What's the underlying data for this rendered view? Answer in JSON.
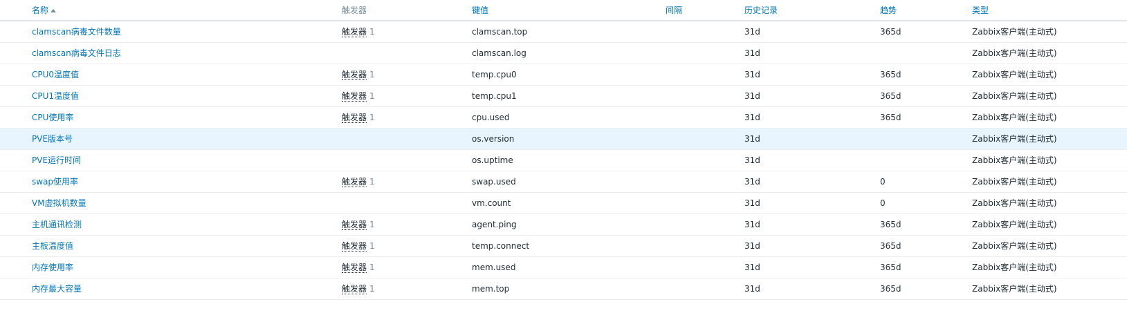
{
  "colors": {
    "link": "#0275b8",
    "header_muted": "#768d99",
    "highlight_row": "#e8f5ff",
    "text": "#1f2c33"
  },
  "header": {
    "name": "名称",
    "triggers": "触发器",
    "key": "键值",
    "interval": "间隔",
    "history": "历史记录",
    "trends": "趋势",
    "type": "类型",
    "sort_icon": "sort-ascending-icon"
  },
  "rows": [
    {
      "name": "clamscan病毒文件数量",
      "trigger_label": "触发器",
      "trigger_count": "1",
      "key": "clamscan.top",
      "interval": "",
      "history": "31d",
      "trends": "365d",
      "type": "Zabbix客户端(主动式)"
    },
    {
      "name": "clamscan病毒文件日志",
      "trigger_label": "",
      "trigger_count": "",
      "key": "clamscan.log",
      "interval": "",
      "history": "31d",
      "trends": "",
      "type": "Zabbix客户端(主动式)"
    },
    {
      "name": "CPU0温度值",
      "trigger_label": "触发器",
      "trigger_count": "1",
      "key": "temp.cpu0",
      "interval": "",
      "history": "31d",
      "trends": "365d",
      "type": "Zabbix客户端(主动式)"
    },
    {
      "name": "CPU1温度值",
      "trigger_label": "触发器",
      "trigger_count": "1",
      "key": "temp.cpu1",
      "interval": "",
      "history": "31d",
      "trends": "365d",
      "type": "Zabbix客户端(主动式)"
    },
    {
      "name": "CPU使用率",
      "trigger_label": "触发器",
      "trigger_count": "1",
      "key": "cpu.used",
      "interval": "",
      "history": "31d",
      "trends": "365d",
      "type": "Zabbix客户端(主动式)"
    },
    {
      "name": "PVE版本号",
      "trigger_label": "",
      "trigger_count": "",
      "key": "os.version",
      "interval": "",
      "history": "31d",
      "trends": "",
      "type": "Zabbix客户端(主动式)",
      "highlighted": true
    },
    {
      "name": "PVE运行时间",
      "trigger_label": "",
      "trigger_count": "",
      "key": "os.uptime",
      "interval": "",
      "history": "31d",
      "trends": "",
      "type": "Zabbix客户端(主动式)"
    },
    {
      "name": "swap使用率",
      "trigger_label": "触发器",
      "trigger_count": "1",
      "key": "swap.used",
      "interval": "",
      "history": "31d",
      "trends": "0",
      "type": "Zabbix客户端(主动式)"
    },
    {
      "name": "VM虚拟机数量",
      "trigger_label": "",
      "trigger_count": "",
      "key": "vm.count",
      "interval": "",
      "history": "31d",
      "trends": "0",
      "type": "Zabbix客户端(主动式)"
    },
    {
      "name": "主机通讯检测",
      "trigger_label": "触发器",
      "trigger_count": "1",
      "key": "agent.ping",
      "interval": "",
      "history": "31d",
      "trends": "365d",
      "type": "Zabbix客户端(主动式)"
    },
    {
      "name": "主板温度值",
      "trigger_label": "触发器",
      "trigger_count": "1",
      "key": "temp.connect",
      "interval": "",
      "history": "31d",
      "trends": "365d",
      "type": "Zabbix客户端(主动式)"
    },
    {
      "name": "内存使用率",
      "trigger_label": "触发器",
      "trigger_count": "1",
      "key": "mem.used",
      "interval": "",
      "history": "31d",
      "trends": "365d",
      "type": "Zabbix客户端(主动式)"
    },
    {
      "name": "内存最大容量",
      "trigger_label": "触发器",
      "trigger_count": "1",
      "key": "mem.top",
      "interval": "",
      "history": "31d",
      "trends": "365d",
      "type": "Zabbix客户端(主动式)"
    }
  ]
}
